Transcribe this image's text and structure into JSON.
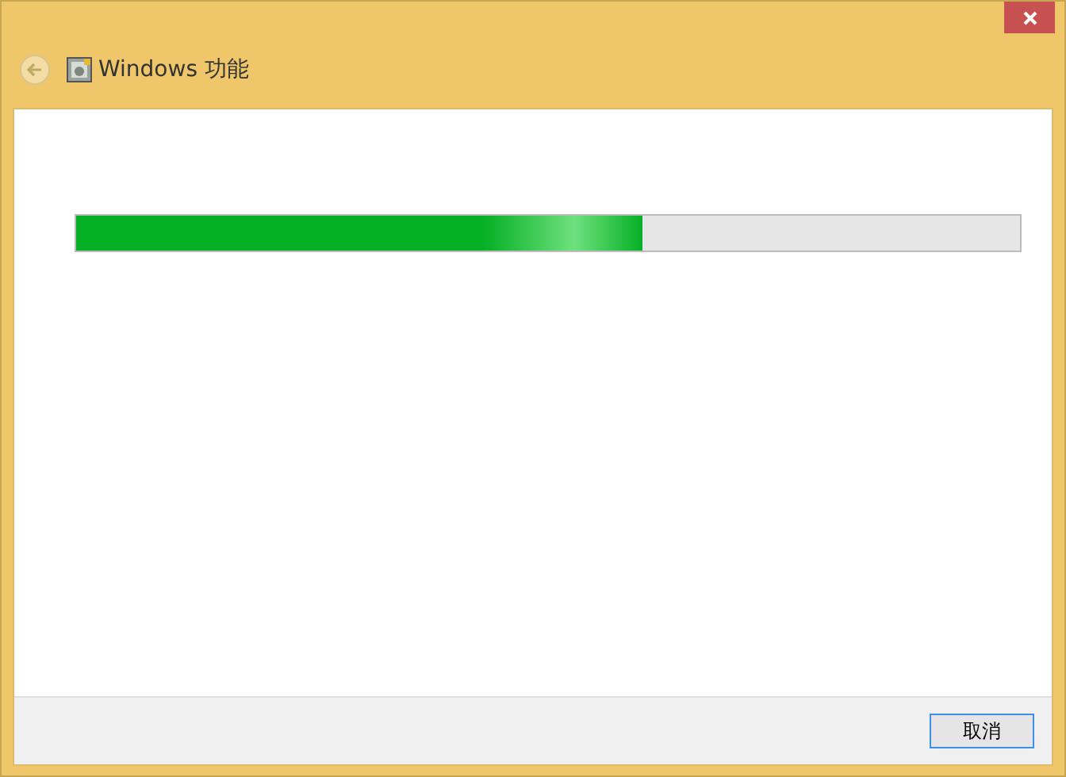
{
  "window": {
    "title": "Windows 功能"
  },
  "progress": {
    "level": 0.6
  },
  "buttons": [
    "取消"
  ]
}
